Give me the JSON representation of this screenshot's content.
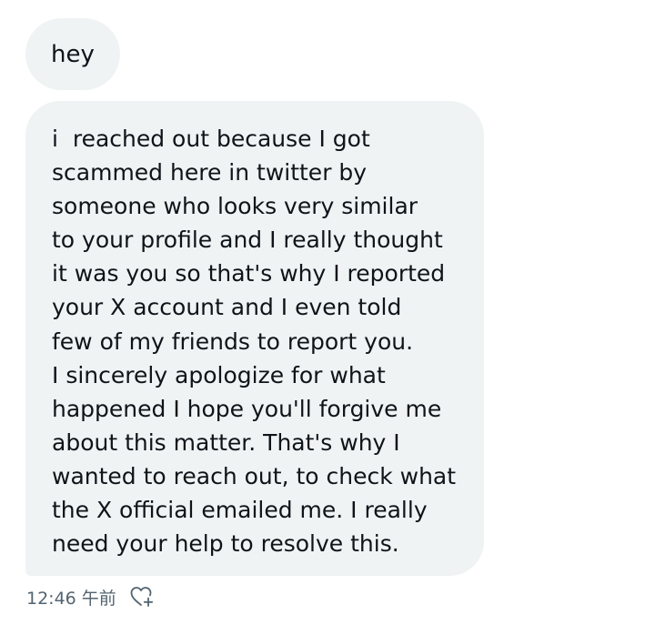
{
  "messages": [
    {
      "lines": [
        "hey"
      ]
    },
    {
      "lines": [
        "i  reached out because I got",
        "scammed here in twitter by",
        "someone who looks very similar",
        "to your profile and I really thought",
        "it was you so that's why I reported",
        "your X account and I even told",
        "few of my friends to report you.",
        "I sincerely apologize for what",
        "happened I hope you'll forgive me",
        "about this matter. That's why I",
        "wanted to reach out, to check what",
        "the X official emailed me. I really",
        "need your help to resolve this."
      ]
    }
  ],
  "meta": {
    "timestamp": "12:46 午前",
    "reaction_icon": "heart-plus-icon"
  },
  "colors": {
    "bubble_bg": "#eff3f4",
    "text": "#0f1419",
    "meta_text": "#536471"
  }
}
